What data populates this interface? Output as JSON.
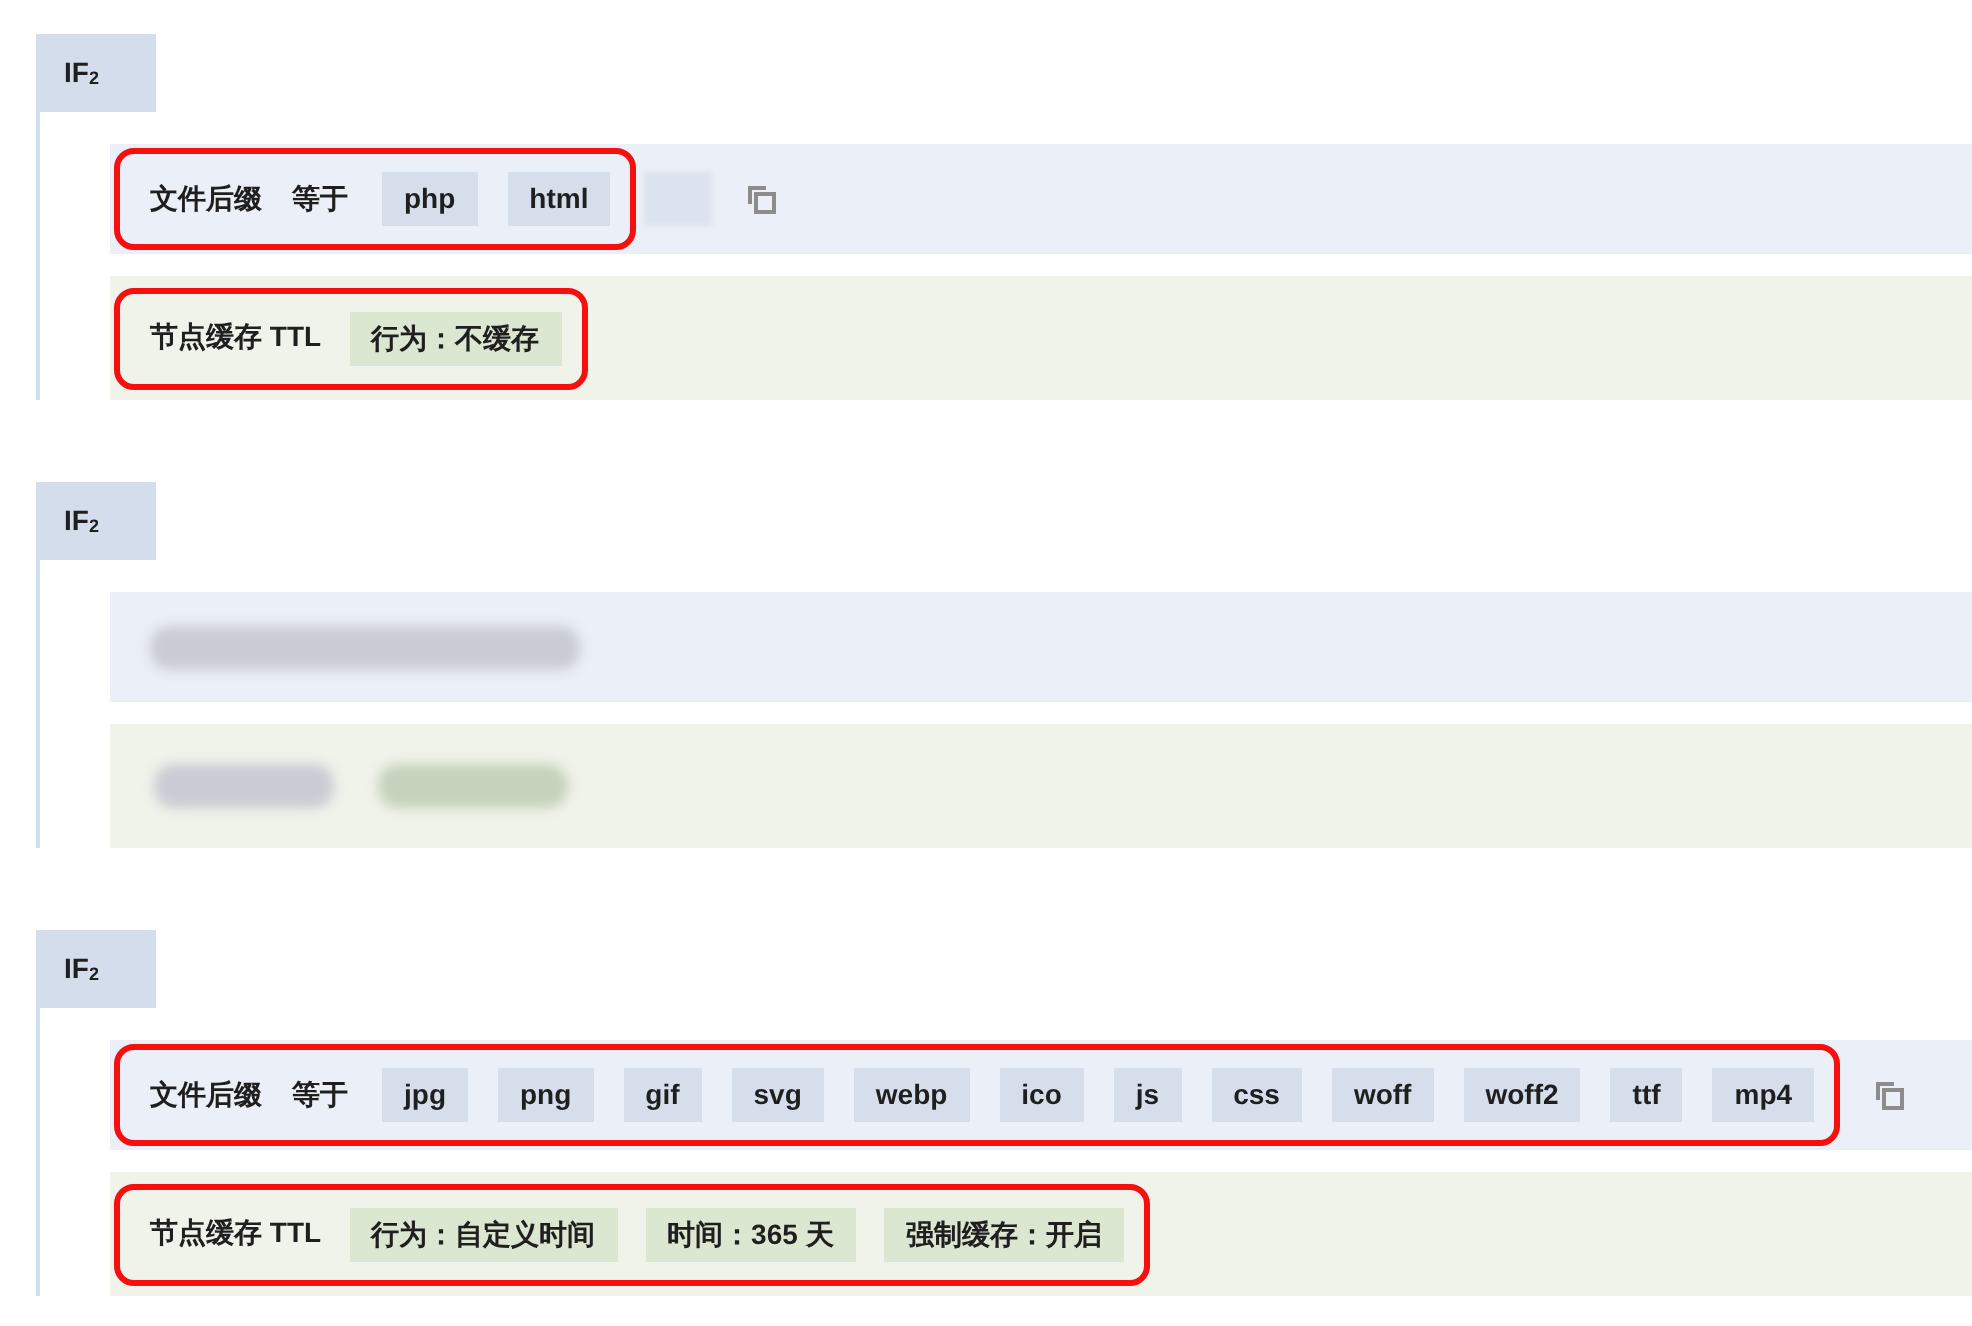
{
  "blocks": [
    {
      "label": "IF$_{2}$",
      "condition": {
        "kind": "filled",
        "field": "文件后缀",
        "operator": "等于",
        "highlighted": true,
        "values": [
          {
            "kind": "tag",
            "text": "php"
          },
          {
            "kind": "tag",
            "text": "html"
          },
          {
            "kind": "blurred"
          }
        ]
      },
      "action": {
        "kind": "filled",
        "name": "节点缓存 TTL",
        "highlighted": true,
        "tags": [
          {
            "text": "行为：不缓存"
          }
        ]
      }
    },
    {
      "label": "IF$_{2}$",
      "condition": {
        "kind": "blurred"
      },
      "action": {
        "kind": "blurred"
      }
    },
    {
      "label": "IF$_{2}$",
      "condition": {
        "kind": "filled",
        "field": "文件后缀",
        "operator": "等于",
        "highlighted": true,
        "values": [
          {
            "kind": "tag",
            "text": "jpg"
          },
          {
            "kind": "tag",
            "text": "png"
          },
          {
            "kind": "tag",
            "text": "gif"
          },
          {
            "kind": "tag",
            "text": "svg"
          },
          {
            "kind": "tag",
            "text": "webp"
          },
          {
            "kind": "tag",
            "text": "ico"
          },
          {
            "kind": "tag",
            "text": "js"
          },
          {
            "kind": "tag",
            "text": "css"
          },
          {
            "kind": "tag",
            "text": "woff"
          },
          {
            "kind": "tag",
            "text": "woff2"
          },
          {
            "kind": "tag",
            "text": "ttf"
          },
          {
            "kind": "tag",
            "text": "mp4"
          }
        ]
      },
      "action": {
        "kind": "filled",
        "name": "节点缓存 TTL",
        "highlighted": true,
        "tags": [
          {
            "text": "行为：自定义时间"
          },
          {
            "text": "时间：365 天"
          },
          {
            "text": "强制缓存：开启"
          }
        ]
      }
    }
  ]
}
